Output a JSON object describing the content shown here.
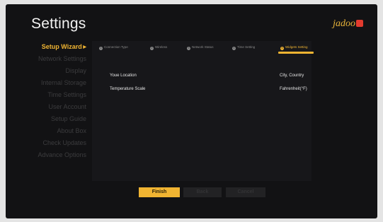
{
  "header": {
    "title": "Settings",
    "logo": "jadoo"
  },
  "sidebar": {
    "items": [
      {
        "label": "Setup Wizard",
        "active": true
      },
      {
        "label": "Network Settings"
      },
      {
        "label": "Display"
      },
      {
        "label": "Internal Storage"
      },
      {
        "label": "Time Settings"
      },
      {
        "label": "User Account"
      },
      {
        "label": "Setup Guide"
      },
      {
        "label": "About Box"
      },
      {
        "label": "Check Updates"
      },
      {
        "label": "Advance Options"
      }
    ]
  },
  "wizard": {
    "steps": [
      {
        "num": "1",
        "label": "Connection Type"
      },
      {
        "num": "2",
        "label": "Wireless"
      },
      {
        "num": "3",
        "label": "Network Status"
      },
      {
        "num": "4",
        "label": "Time Setting"
      },
      {
        "num": "5",
        "label": "Widgets Setting",
        "active": true
      }
    ],
    "rows": [
      {
        "label": "Youe Location",
        "value": "City, Country"
      },
      {
        "label": "Temperature Scale",
        "value": "Fahrenheit(°F)"
      }
    ]
  },
  "buttons": {
    "finish": "Finish",
    "back": "Back",
    "cancel": "Cancel"
  },
  "colors": {
    "accent": "#f0b432",
    "background": "#121214",
    "logo_red": "#e23b2e"
  }
}
